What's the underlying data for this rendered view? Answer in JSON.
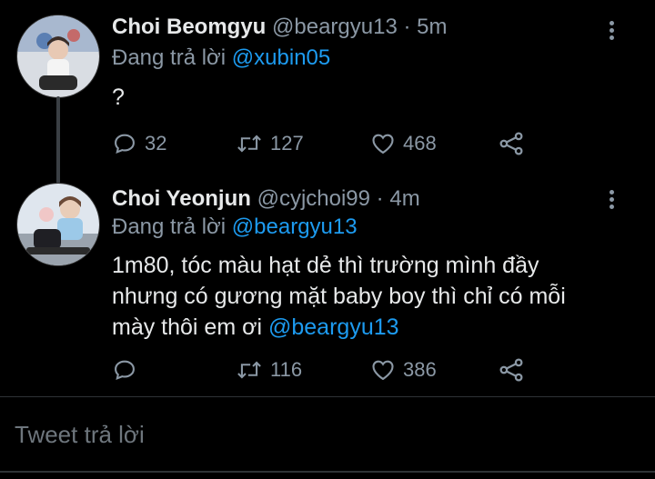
{
  "tweets": [
    {
      "name": "Choi Beomgyu",
      "handle": "@beargyu13",
      "sep": "·",
      "time": "5m",
      "reply_prefix": "Đang trả lời ",
      "reply_to": "@xubin05",
      "text": "?",
      "counts": {
        "reply": "32",
        "retweet": "127",
        "like": "468"
      }
    },
    {
      "name": "Choi Yeonjun",
      "handle": "@cyjchoi99",
      "sep": "·",
      "time": "4m",
      "reply_prefix": "Đang trả lời ",
      "reply_to": "@beargyu13",
      "text_line1": "1m80, tóc màu hạt dẻ thì trường mình đầy",
      "text_line2": "nhưng có gương mặt baby boy thì chỉ có mỗi",
      "text_line3_prefix": "mày thôi em ơi ",
      "text_line3_mention": "@beargyu13",
      "counts": {
        "reply": "",
        "retweet": "116",
        "like": "386"
      }
    }
  ],
  "composer": {
    "placeholder": "Tweet trả lời"
  },
  "icons": [
    "reply-icon",
    "retweet-icon",
    "like-icon",
    "share-icon",
    "more-icon"
  ],
  "colors": {
    "background": "#000000",
    "text": "#e7e9ea",
    "muted": "#8b98a5",
    "accent": "#1d9bf0"
  }
}
